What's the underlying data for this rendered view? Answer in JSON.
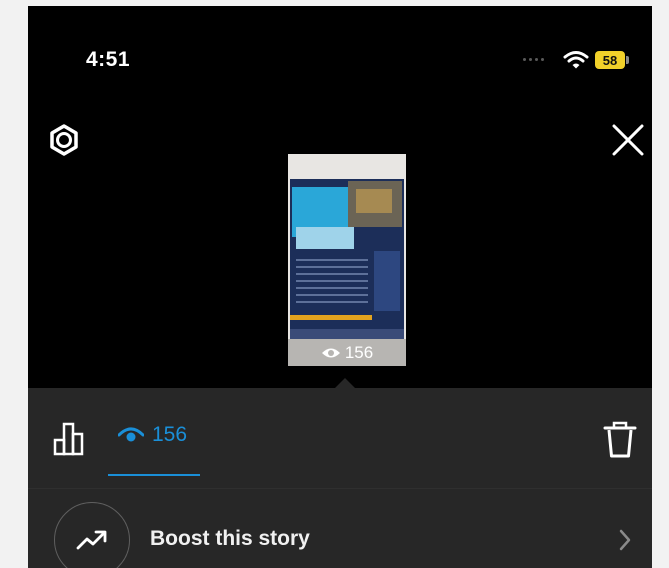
{
  "status_bar": {
    "time": "4:51",
    "battery": "58"
  },
  "story": {
    "views": "156"
  },
  "insights": {
    "views": "156"
  },
  "boost": {
    "label": "Boost this story"
  }
}
